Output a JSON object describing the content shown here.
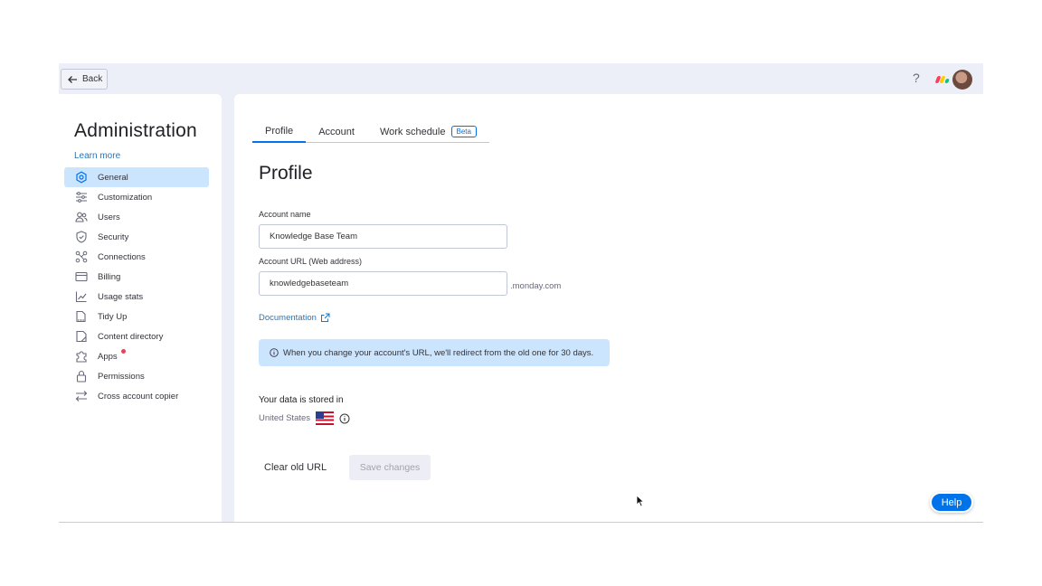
{
  "topbar": {
    "back_label": "Back",
    "help_symbol": "?",
    "logo_colors": [
      "#ff3d57",
      "#ffcb00",
      "#00ca72"
    ]
  },
  "sidebar": {
    "title": "Administration",
    "learn_more": "Learn more",
    "items": [
      {
        "label": "General",
        "icon": "gear-icon",
        "active": true
      },
      {
        "label": "Customization",
        "icon": "sliders-icon"
      },
      {
        "label": "Users",
        "icon": "users-icon"
      },
      {
        "label": "Security",
        "icon": "shield-icon"
      },
      {
        "label": "Connections",
        "icon": "connections-icon"
      },
      {
        "label": "Billing",
        "icon": "credit-card-icon"
      },
      {
        "label": "Usage stats",
        "icon": "chart-icon"
      },
      {
        "label": "Tidy Up",
        "icon": "broom-icon"
      },
      {
        "label": "Content directory",
        "icon": "document-icon"
      },
      {
        "label": "Apps",
        "icon": "puzzle-icon",
        "notification": true
      },
      {
        "label": "Permissions",
        "icon": "lock-icon"
      },
      {
        "label": "Cross account copier",
        "icon": "arrows-swap-icon"
      }
    ]
  },
  "main": {
    "tabs": [
      {
        "label": "Profile",
        "active": true
      },
      {
        "label": "Account"
      },
      {
        "label": "Work schedule",
        "badge": "Beta"
      }
    ],
    "page_title": "Profile",
    "account_name_label": "Account name",
    "account_name_value": "Knowledge Base Team",
    "account_url_label": "Account URL (Web address)",
    "account_url_value": "knowledgebaseteam",
    "url_suffix": ".monday.com",
    "documentation_link": "Documentation",
    "info_message": "When you change your account's URL, we'll redirect from the old one for 30 days.",
    "data_stored_title": "Your data is stored in",
    "data_region": "United States",
    "clear_button": "Clear old URL",
    "save_button": "Save changes"
  },
  "help_button": "Help",
  "colors": {
    "accent": "#0073ea",
    "active_bg": "#cce5ff",
    "link": "#1f76c2"
  }
}
